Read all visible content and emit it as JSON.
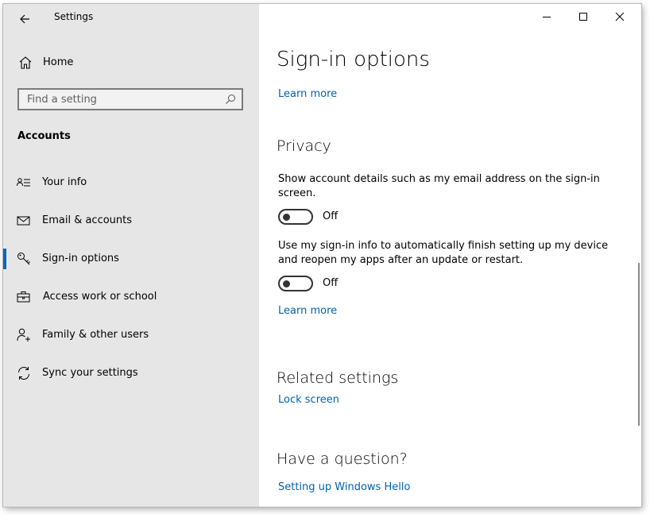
{
  "window": {
    "title": "Settings"
  },
  "sidebar": {
    "home_label": "Home",
    "search_placeholder": "Find a setting",
    "section_title": "Accounts",
    "items": [
      {
        "label": "Your info",
        "icon": "person-card-icon"
      },
      {
        "label": "Email & accounts",
        "icon": "mail-icon"
      },
      {
        "label": "Sign-in options",
        "icon": "key-icon",
        "active": true
      },
      {
        "label": "Access work or school",
        "icon": "briefcase-icon"
      },
      {
        "label": "Family & other users",
        "icon": "add-person-icon"
      },
      {
        "label": "Sync your settings",
        "icon": "sync-icon"
      }
    ]
  },
  "main": {
    "title": "Sign-in options",
    "learn_more_top": "Learn more",
    "privacy": {
      "heading": "Privacy",
      "setting1_text": "Show account details such as my email address on the sign-in screen.",
      "setting1_state": "Off",
      "setting2_text": "Use my sign-in info to automatically finish setting up my device and reopen my apps after an update or restart.",
      "setting2_state": "Off",
      "learn_more": "Learn more"
    },
    "related": {
      "heading": "Related settings",
      "link1": "Lock screen"
    },
    "question": {
      "heading": "Have a question?",
      "link1": "Setting up Windows Hello"
    }
  },
  "colors": {
    "accent": "#0067c0",
    "link": "#0063b1",
    "sidebar_bg": "#e6e6e6"
  }
}
